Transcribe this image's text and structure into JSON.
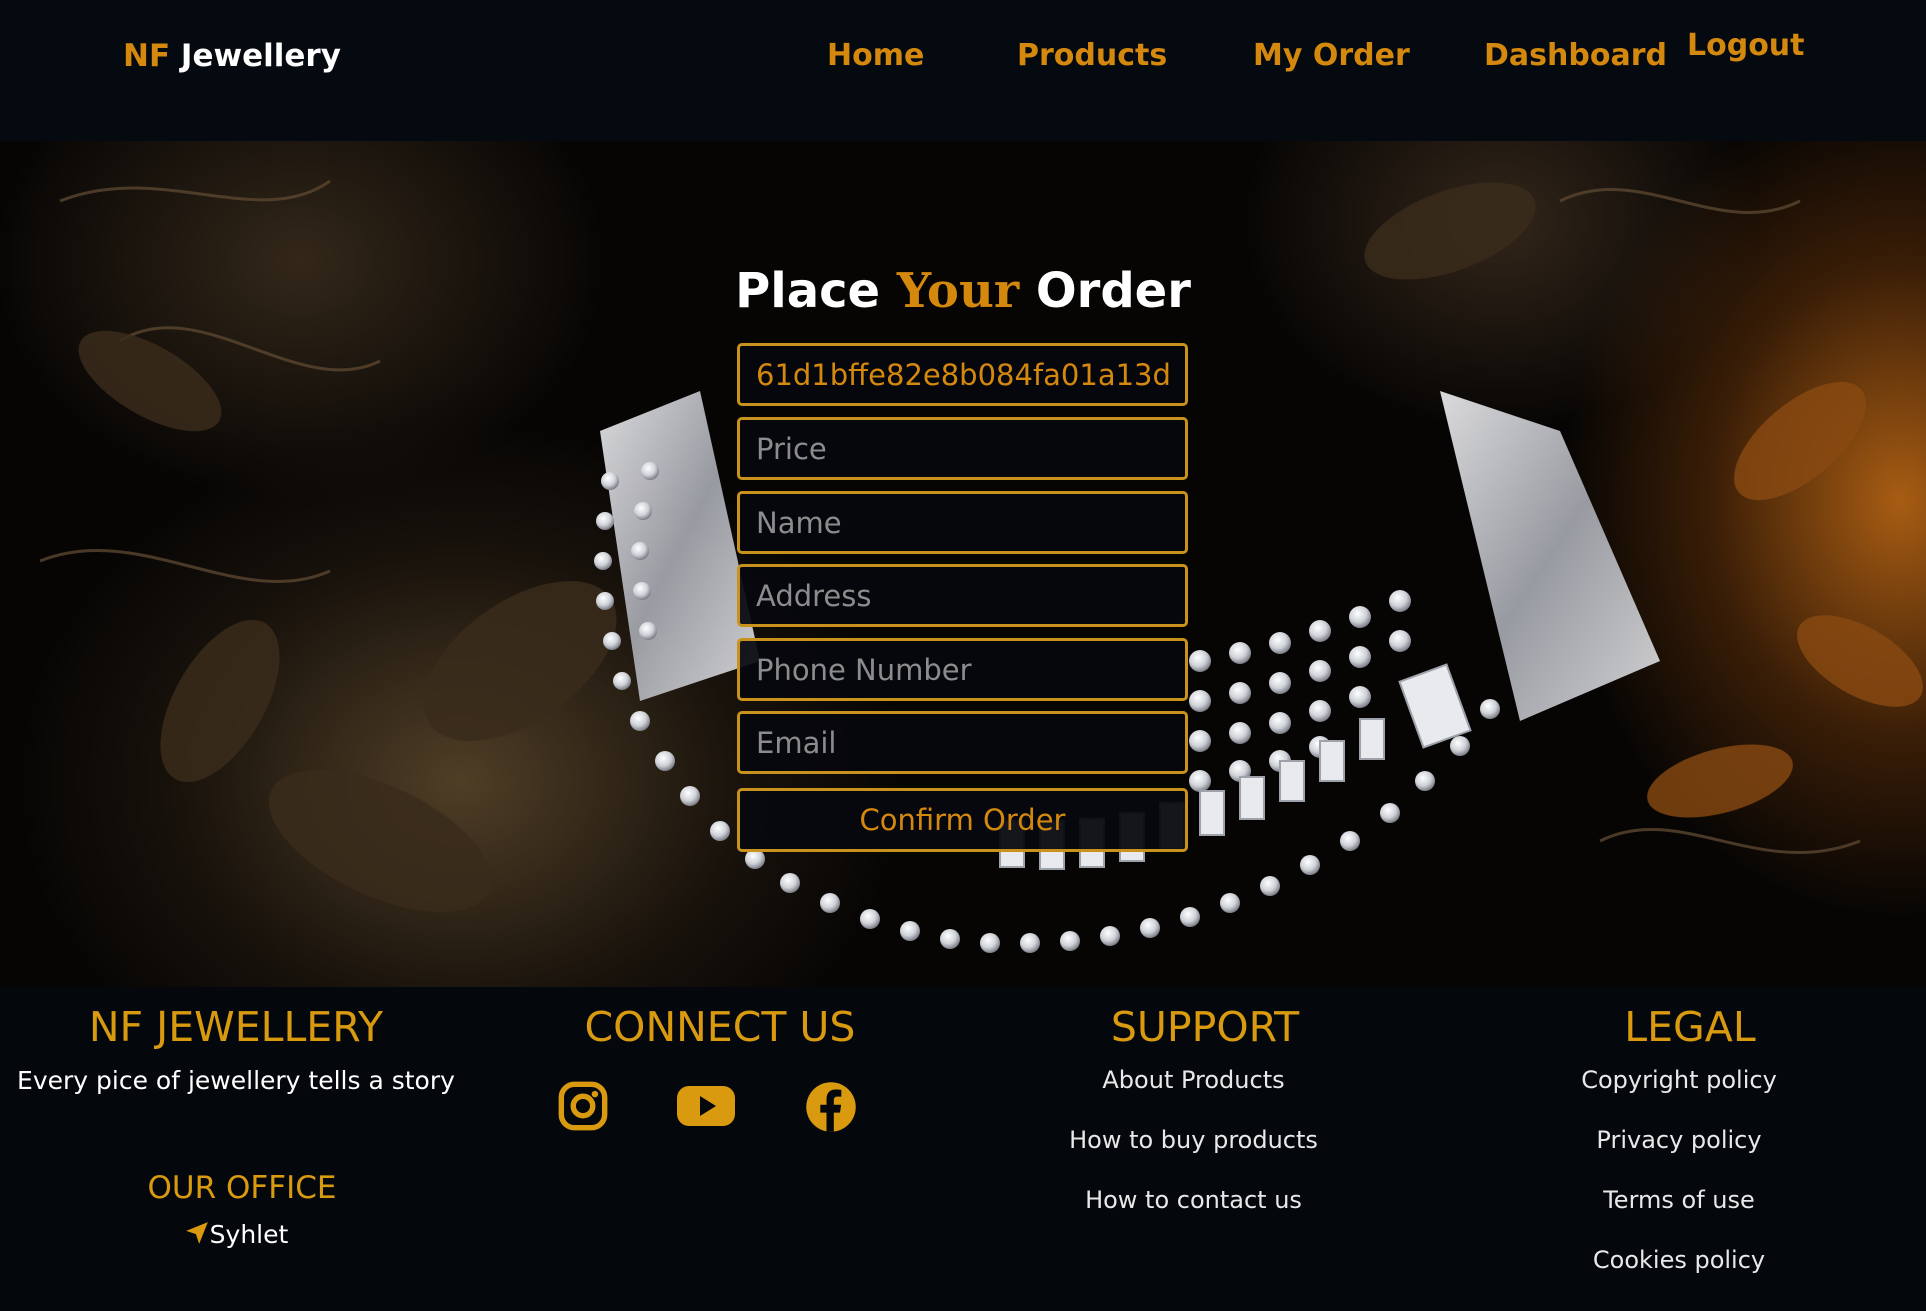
{
  "navbar": {
    "brand_part1": "NF",
    "brand_part2": "Jewellery",
    "links": [
      "Home",
      "Products",
      "My Order",
      "Dashboard",
      "Logout"
    ]
  },
  "order_form": {
    "title_part1": "Place",
    "title_part2": "Your",
    "title_part3": "Order",
    "product_id_value": "61d1bffe82e8b084fa01a13d",
    "price_placeholder": "Price",
    "name_placeholder": "Name",
    "address_placeholder": "Address",
    "phone_placeholder": "Phone Number",
    "email_placeholder": "Email",
    "confirm_label": "Confirm Order"
  },
  "footer": {
    "brand_heading": "NF JEWELLERY",
    "tagline": "Every pice of jewellery tells a story",
    "office_heading": "OUR OFFICE",
    "office_location": "Syhlet",
    "connect_heading": "CONNECT US",
    "social_icons": [
      "instagram-icon",
      "youtube-icon",
      "facebook-icon"
    ],
    "support_heading": "SUPPORT",
    "support_links": [
      "About Products",
      "How to buy products",
      "How to contact us"
    ],
    "legal_heading": "LEGAL",
    "legal_links": [
      "Copyright policy",
      "Privacy policy",
      "Terms of use",
      "Cookies policy"
    ]
  },
  "colors": {
    "accent": "#d4880e",
    "footer_heading": "#d99a10",
    "background": "#04080d",
    "field_border": "#c8921c"
  }
}
